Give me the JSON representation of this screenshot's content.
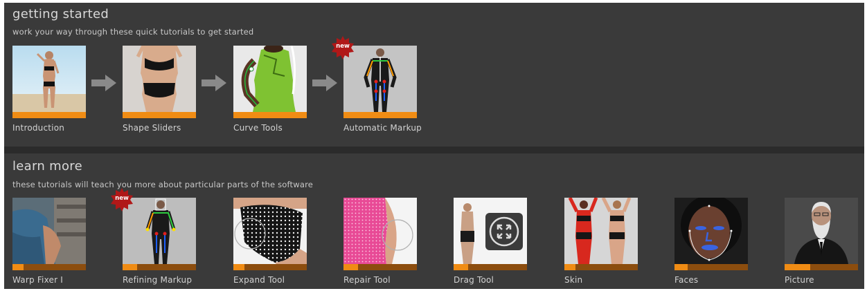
{
  "colors": {
    "panel_bg": "#3a3a3a",
    "progress_track": "#8c4d0e",
    "progress_fill": "#f08c14",
    "badge_red": "#b01818",
    "arrow_gray": "#8a8a8a"
  },
  "getting_started": {
    "title": "getting started",
    "subtitle": "work your way through these quick tutorials to get started",
    "tiles": [
      {
        "label": "Introduction",
        "progress": 1.0,
        "badge": ""
      },
      {
        "label": "Shape Sliders",
        "progress": 1.0,
        "badge": ""
      },
      {
        "label": "Curve Tools",
        "progress": 1.0,
        "badge": ""
      },
      {
        "label": "Automatic Markup",
        "progress": 1.0,
        "badge": "new"
      }
    ]
  },
  "learn_more": {
    "title": "learn more",
    "subtitle": "these tutorials will teach you more about particular parts of the software",
    "tiles": [
      {
        "label": "Warp Fixer I",
        "progress": 0.15,
        "badge": ""
      },
      {
        "label": "Refining Markup",
        "progress": 0.2,
        "badge": "new"
      },
      {
        "label": "Expand Tool",
        "progress": 0.15,
        "badge": ""
      },
      {
        "label": "Repair Tool",
        "progress": 0.2,
        "badge": ""
      },
      {
        "label": "Drag Tool",
        "progress": 0.2,
        "badge": ""
      },
      {
        "label": "Skin",
        "progress": 0.15,
        "badge": ""
      },
      {
        "label": "Faces",
        "progress": 0.18,
        "badge": ""
      },
      {
        "label": "Picture",
        "progress": 0.35,
        "badge": ""
      }
    ]
  }
}
